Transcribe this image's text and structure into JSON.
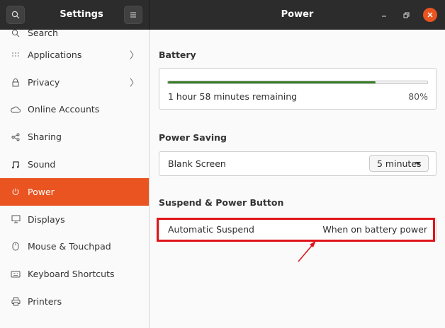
{
  "header": {
    "app_title": "Settings",
    "page_title": "Power",
    "search_icon": "search-icon",
    "menu_icon": "hamburger-menu-icon",
    "window_controls": [
      "minimize",
      "maximize",
      "close"
    ]
  },
  "sidebar": {
    "items": [
      {
        "label": "Search",
        "icon": "search-icon"
      },
      {
        "label": "Applications",
        "icon": "grid-icon",
        "has_chevron": true
      },
      {
        "label": "Privacy",
        "icon": "lock-icon",
        "has_chevron": true
      },
      {
        "label": "Online Accounts",
        "icon": "cloud-icon"
      },
      {
        "label": "Sharing",
        "icon": "share-icon"
      },
      {
        "label": "Sound",
        "icon": "music-note-icon"
      },
      {
        "label": "Power",
        "icon": "power-icon",
        "active": true
      },
      {
        "label": "Displays",
        "icon": "display-icon"
      },
      {
        "label": "Mouse & Touchpad",
        "icon": "mouse-icon"
      },
      {
        "label": "Keyboard Shortcuts",
        "icon": "keyboard-icon"
      },
      {
        "label": "Printers",
        "icon": "printer-icon"
      }
    ]
  },
  "battery": {
    "title": "Battery",
    "remaining": "1 hour 58 minutes remaining",
    "percent_label": "80%",
    "level": 0.8
  },
  "power_saving": {
    "title": "Power Saving",
    "blank_screen_label": "Blank Screen",
    "blank_screen_value": "5 minutes"
  },
  "suspend": {
    "title": "Suspend & Power Button",
    "automatic_suspend_label": "Automatic Suspend",
    "automatic_suspend_value": "When on battery power"
  },
  "colors": {
    "accent": "#e95420",
    "titlebar": "#2c2c2c",
    "battery_fill": "#3a7d2a",
    "annotation": "#e0151b"
  }
}
